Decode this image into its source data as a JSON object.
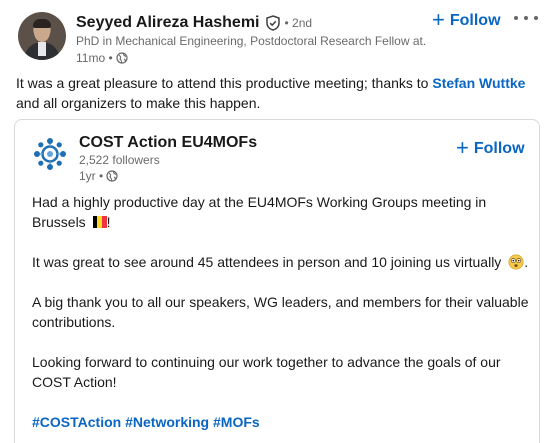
{
  "author": {
    "name": "Seyyed Alireza Hashemi",
    "degree": "• 2nd",
    "headline": "PhD in Mechanical Engineering, Postdoctoral Research Fellow at...",
    "time": "11mo •"
  },
  "follow_label": "Follow",
  "follow_plus": "+",
  "commentary": {
    "before": "It was a great pleasure to attend this productive meeting; thanks to ",
    "mention": "Stefan Wuttke",
    "after": " and all organizers to make this happen."
  },
  "reshared": {
    "org_name": "COST Action EU4MOFs",
    "followers": "2,522 followers",
    "time": "1yr •",
    "paragraphs": {
      "p1": "Had a highly productive day at the EU4MOFs Working Groups meeting in Brussels",
      "p1_end": "!",
      "p2": "It was great to see around 45 attendees in person and 10 joining us virtually",
      "p2_end": ".",
      "p3": "A big thank you to all our speakers, WG leaders, and members for their valuable contributions.",
      "p4": "Looking forward to continuing our work together to advance the goals of our COST Action!"
    },
    "hashtags": [
      "#COSTAction",
      "#Networking",
      "#MOFs"
    ]
  },
  "colors": {
    "link_blue": "#0a66c2",
    "belgium_black": "#000000",
    "belgium_yellow": "#fdda24",
    "belgium_red": "#ef3340"
  },
  "icons": {
    "verified": "verified-shield-icon",
    "visibility": "globe-icon",
    "more": "more-horizontal-icon",
    "flag": "belgium-flag-icon",
    "emoji": "star-struck-emoji-icon"
  }
}
